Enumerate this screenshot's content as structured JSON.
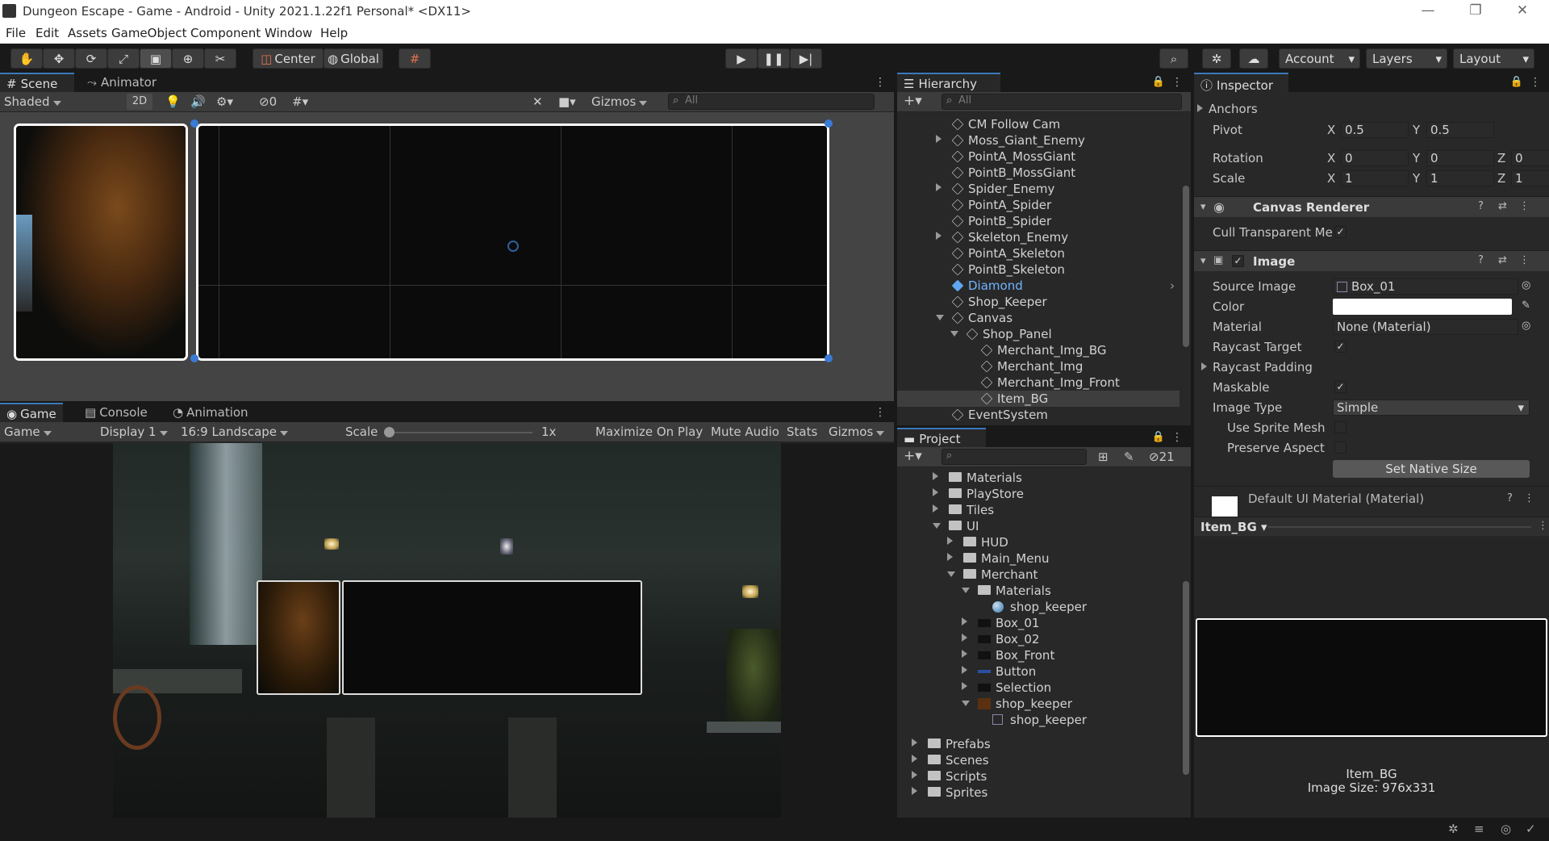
{
  "window": {
    "title": "Dungeon Escape - Game - Android - Unity 2021.1.22f1 Personal* <DX11>"
  },
  "menu": [
    "File",
    "Edit",
    "Assets",
    "GameObject",
    "Component",
    "Window",
    "Help"
  ],
  "toolbar": {
    "center": "Center",
    "global": "Global",
    "account": "Account",
    "layers": "Layers",
    "layout": "Layout"
  },
  "scene": {
    "tabs": [
      "Scene",
      "Animator"
    ],
    "shading": "Shaded",
    "mode2d": "2D",
    "hidden_count": "0",
    "gizmos": "Gizmos",
    "search_placeholder": "All"
  },
  "game": {
    "tabs": [
      "Game",
      "Console",
      "Animation"
    ],
    "view": "Game",
    "display": "Display 1",
    "aspect": "16:9 Landscape",
    "scale_label": "Scale",
    "scale_value": "1x",
    "maximize": "Maximize On Play",
    "mute": "Mute Audio",
    "stats": "Stats",
    "gizmos": "Gizmos"
  },
  "hierarchy": {
    "title": "Hierarchy",
    "search_placeholder": "All",
    "items": [
      {
        "label": "CM Follow Cam",
        "depth": 0,
        "arrow": "none"
      },
      {
        "label": "Moss_Giant_Enemy",
        "depth": 0,
        "arrow": "closed"
      },
      {
        "label": "PointA_MossGiant",
        "depth": 0,
        "arrow": "none"
      },
      {
        "label": "PointB_MossGiant",
        "depth": 0,
        "arrow": "none"
      },
      {
        "label": "Spider_Enemy",
        "depth": 0,
        "arrow": "closed"
      },
      {
        "label": "PointA_Spider",
        "depth": 0,
        "arrow": "none"
      },
      {
        "label": "PointB_Spider",
        "depth": 0,
        "arrow": "none"
      },
      {
        "label": "Skeleton_Enemy",
        "depth": 0,
        "arrow": "closed"
      },
      {
        "label": "PointA_Skeleton",
        "depth": 0,
        "arrow": "none"
      },
      {
        "label": "PointB_Skeleton",
        "depth": 0,
        "arrow": "none"
      },
      {
        "label": "Diamond",
        "depth": 0,
        "arrow": "none",
        "prefab": true
      },
      {
        "label": "Shop_Keeper",
        "depth": 0,
        "arrow": "none"
      },
      {
        "label": "Canvas",
        "depth": 0,
        "arrow": "open"
      },
      {
        "label": "Shop_Panel",
        "depth": 1,
        "arrow": "open"
      },
      {
        "label": "Merchant_Img_BG",
        "depth": 2,
        "arrow": "none"
      },
      {
        "label": "Merchant_Img",
        "depth": 2,
        "arrow": "none"
      },
      {
        "label": "Merchant_Img_Front",
        "depth": 2,
        "arrow": "none"
      },
      {
        "label": "Item_BG",
        "depth": 2,
        "arrow": "none",
        "selected": true
      },
      {
        "label": "EventSystem",
        "depth": 0,
        "arrow": "none"
      }
    ]
  },
  "project": {
    "title": "Project",
    "hidden_count": "21",
    "items": [
      {
        "label": "Materials",
        "depth": 0,
        "arrow": "closed",
        "type": "folder"
      },
      {
        "label": "PlayStore",
        "depth": 0,
        "arrow": "closed",
        "type": "folder"
      },
      {
        "label": "Tiles",
        "depth": 0,
        "arrow": "closed",
        "type": "folder"
      },
      {
        "label": "UI",
        "depth": 0,
        "arrow": "open",
        "type": "folder"
      },
      {
        "label": "HUD",
        "depth": 1,
        "arrow": "closed",
        "type": "folder"
      },
      {
        "label": "Main_Menu",
        "depth": 1,
        "arrow": "closed",
        "type": "folder"
      },
      {
        "label": "Merchant",
        "depth": 1,
        "arrow": "open",
        "type": "folder"
      },
      {
        "label": "Materials",
        "depth": 2,
        "arrow": "open",
        "type": "folder"
      },
      {
        "label": "shop_keeper",
        "depth": 3,
        "arrow": "none",
        "type": "material"
      },
      {
        "label": "Box_01",
        "depth": 2,
        "arrow": "closed",
        "type": "sprite"
      },
      {
        "label": "Box_02",
        "depth": 2,
        "arrow": "closed",
        "type": "sprite"
      },
      {
        "label": "Box_Front",
        "depth": 2,
        "arrow": "closed",
        "type": "sprite"
      },
      {
        "label": "Button",
        "depth": 2,
        "arrow": "closed",
        "type": "sprite"
      },
      {
        "label": "Selection",
        "depth": 2,
        "arrow": "closed",
        "type": "sprite"
      },
      {
        "label": "shop_keeper",
        "depth": 2,
        "arrow": "open",
        "type": "sprite"
      },
      {
        "label": "shop_keeper",
        "depth": 3,
        "arrow": "none",
        "type": "subsprite"
      },
      {
        "label": "Prefabs",
        "depth": -1,
        "arrow": "closed",
        "type": "folder"
      },
      {
        "label": "Scenes",
        "depth": -1,
        "arrow": "closed",
        "type": "folder"
      },
      {
        "label": "Scripts",
        "depth": -1,
        "arrow": "closed",
        "type": "folder"
      },
      {
        "label": "Sprites",
        "depth": -1,
        "arrow": "closed",
        "type": "folder"
      }
    ]
  },
  "inspector": {
    "title": "Inspector",
    "anchors": "Anchors",
    "pivot": {
      "label": "Pivot",
      "x": "0.5",
      "y": "0.5"
    },
    "rotation": {
      "label": "Rotation",
      "x": "0",
      "y": "0",
      "z": "0"
    },
    "scale": {
      "label": "Scale",
      "x": "1",
      "y": "1",
      "z": "1"
    },
    "canvas_renderer": {
      "title": "Canvas Renderer",
      "cull": "Cull Transparent Me"
    },
    "image": {
      "title": "Image",
      "source_label": "Source Image",
      "source_value": "Box_01",
      "color_label": "Color",
      "material_label": "Material",
      "material_value": "None (Material)",
      "raycast_target": "Raycast Target",
      "raycast_padding": "Raycast Padding",
      "maskable": "Maskable",
      "image_type_label": "Image Type",
      "image_type_value": "Simple",
      "use_sprite_mesh": "Use Sprite Mesh",
      "preserve_aspect": "Preserve Aspect",
      "native_size": "Set Native Size"
    },
    "material_asset": "Default UI Material (Material)",
    "preview_object": "Item_BG",
    "preview_name": "Item_BG",
    "preview_size": "Image Size: 976x331"
  }
}
